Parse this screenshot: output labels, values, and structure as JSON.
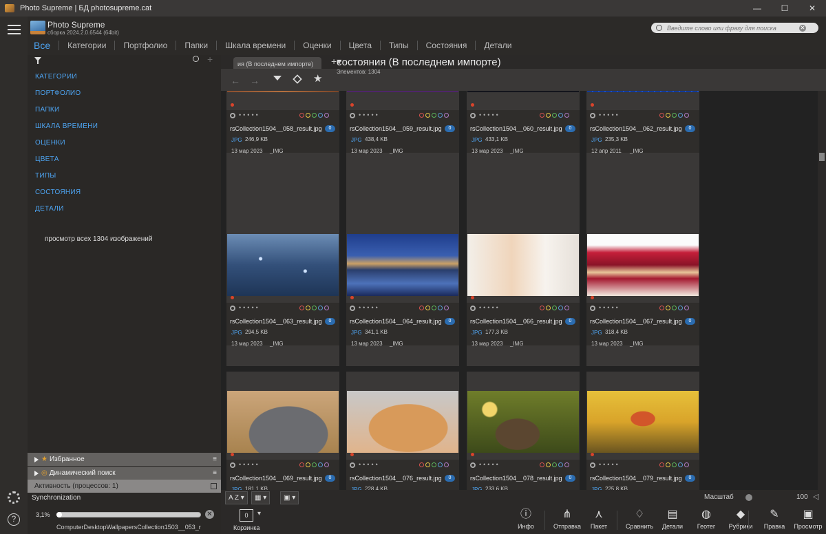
{
  "window": {
    "title": "Photo Supreme | БД photosupreme.cat",
    "controls": [
      "—",
      "☐",
      "✕"
    ]
  },
  "header": {
    "app_name": "Photo Supreme",
    "build": "сборка 2024.2.0.6544 (64bit)",
    "search_placeholder": "Введите слово или фразу для поиска",
    "tabs": [
      "Все",
      "Категории",
      "Портфолио",
      "Папки",
      "Шкала времени",
      "Оценки",
      "Цвета",
      "Типы",
      "Состояния",
      "Детали"
    ]
  },
  "sidebar": {
    "items": [
      "КАТЕГОРИИ",
      "ПОРТФОЛИО",
      "ПАПКИ",
      "ШКАЛА ВРЕМЕНИ",
      "ОЦЕНКИ",
      "ЦВЕТА",
      "ТИПЫ",
      "СОСТОЯНИЯ",
      "ДЕТАЛИ"
    ],
    "view_all": "просмотр всех 1304 изображений",
    "favorites": "Избранное",
    "dynamic_search": "Динамический поиск",
    "activity": "Активность (процессов: 1)"
  },
  "sync": {
    "title": "Synchronization",
    "percent": "3,1%",
    "progress": 0.031,
    "file": "ComputerDesktopWallpapersCollection1503__053_r"
  },
  "content": {
    "tab_label": "ия (В последнем импорте)",
    "title": "состояния (В последнем импорте)",
    "count": "Элементов: 1304"
  },
  "grid": {
    "cards": [
      {
        "name": "rsCollection1504__058_result.jpg",
        "num": "0",
        "ext": "JPG",
        "size": "246,9 KB",
        "date": "13 мар 2023",
        "user": "_IMG",
        "photo": "heart"
      },
      {
        "name": "rsCollection1504__059_result.jpg",
        "num": "0",
        "ext": "JPG",
        "size": "438,4 KB",
        "date": "13 мар 2023",
        "user": "_IMG",
        "photo": "lavender"
      },
      {
        "name": "rsCollection1504__060_result.jpg",
        "num": "0",
        "ext": "JPG",
        "size": "433,1 KB",
        "date": "13 мар 2023",
        "user": "_IMG",
        "photo": "city"
      },
      {
        "name": "rsCollection1504__062_result.jpg",
        "num": "0",
        "ext": "JPG",
        "size": "235,3 KB",
        "date": "12 апр 2011",
        "user": "_IMG",
        "photo": "blue"
      },
      {
        "name": "rsCollection1504__063_result.jpg",
        "num": "0",
        "ext": "JPG",
        "size": "294,5 KB",
        "date": "13 мар 2023",
        "user": "_IMG",
        "photo": "drops"
      },
      {
        "name": "rsCollection1504__064_result.jpg",
        "num": "0",
        "ext": "JPG",
        "size": "341,1 KB",
        "date": "13 мар 2023",
        "user": "_IMG",
        "photo": "harbor"
      },
      {
        "name": "rsCollection1504__066_result.jpg",
        "num": "0",
        "ext": "JPG",
        "size": "177,3 KB",
        "date": "13 мар 2023",
        "user": "_IMG",
        "photo": "woman"
      },
      {
        "name": "rsCollection1504__067_result.jpg",
        "num": "0",
        "ext": "JPG",
        "size": "318,4 KB",
        "date": "13 мар 2023",
        "user": "_IMG",
        "photo": "cake"
      },
      {
        "name": "rsCollection1504__069_result.jpg",
        "num": "0",
        "ext": "JPG",
        "size": "181,1 KB",
        "date": "",
        "user": "",
        "photo": "graycat"
      },
      {
        "name": "rsCollection1504__076_result.jpg",
        "num": "0",
        "ext": "JPG",
        "size": "228,4 KB",
        "date": "",
        "user": "",
        "photo": "gingercat"
      },
      {
        "name": "rsCollection1504__078_result.jpg",
        "num": "0",
        "ext": "JPG",
        "size": "233,6 KB",
        "date": "",
        "user": "",
        "photo": "tabby"
      },
      {
        "name": "rsCollection1504__079_result.jpg",
        "num": "0",
        "ext": "JPG",
        "size": "225,8 KB",
        "date": "",
        "user": "",
        "photo": "redhead"
      }
    ],
    "rating_colors": [
      "#d9534f",
      "#e8c547",
      "#5cb85c",
      "#5b9bd5",
      "#b07cc6"
    ]
  },
  "bottombar": {
    "sort_label": "A Z",
    "zoom_label": "Масштаб",
    "zoom_value": "100"
  },
  "toolbar": {
    "basket_count": "0",
    "basket_label": "Корзинка",
    "items": [
      "Инфо",
      "Отправка",
      "Пакет",
      "Сравнить",
      "Детали",
      "Геотег",
      "Рубрики",
      "Правка",
      "Просмотр"
    ],
    "icons": [
      "info-icon",
      "share-icon",
      "batch-icon",
      "compare-icon",
      "details-icon",
      "geotag-icon",
      "tags-icon",
      "edit-icon",
      "preview-icon"
    ]
  }
}
